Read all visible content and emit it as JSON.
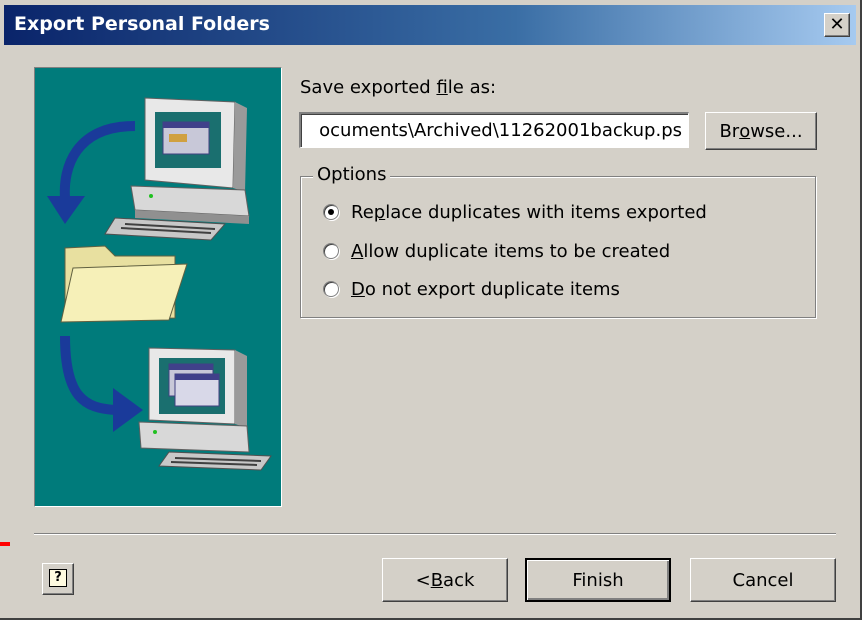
{
  "window": {
    "title": "Export Personal Folders",
    "close_glyph": "✕"
  },
  "save_label": {
    "before": "Save exported ",
    "accel": "f",
    "after": "ile as:"
  },
  "file_path": {
    "value": "ocuments\\Archived\\11262001backup.ps"
  },
  "browse_button": {
    "before": "Br",
    "accel": "o",
    "after": "wse..."
  },
  "options": {
    "legend": "Options",
    "items": [
      {
        "before": "Re",
        "accel": "p",
        "after": "lace duplicates with items exported",
        "selected": true
      },
      {
        "before": "",
        "accel": "A",
        "after": "llow duplicate items to be created",
        "selected": false
      },
      {
        "before": "",
        "accel": "D",
        "after": "o not export duplicate items",
        "selected": false
      }
    ]
  },
  "footer": {
    "back": {
      "before": "< ",
      "accel": "B",
      "after": "ack"
    },
    "finish": "Finish",
    "cancel": "Cancel",
    "help_glyph": "?"
  },
  "colors": {
    "dialog_bg": "#d4d0c8",
    "title_start": "#0a246a",
    "title_end": "#a6caf0",
    "art_bg": "#007b7b"
  },
  "icons": [
    "close-icon",
    "computer-icon",
    "folder-icon",
    "arrow-icon",
    "help-icon"
  ]
}
